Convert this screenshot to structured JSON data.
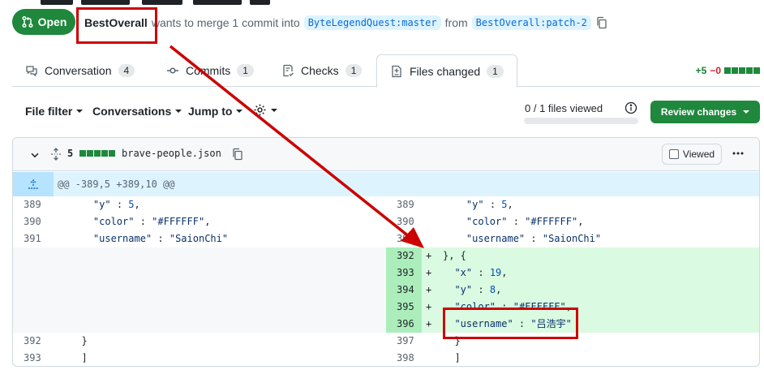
{
  "pr": {
    "state": "Open",
    "author": "BestOverall",
    "text_wants": "wants to merge 1 commit into",
    "base_branch": "ByteLegendQuest:master",
    "text_from": "from",
    "head_branch": "BestOverall:patch-2"
  },
  "tabs": [
    {
      "label": "Conversation",
      "count": "4",
      "icon": "comment-icon"
    },
    {
      "label": "Commits",
      "count": "1",
      "icon": "commit-icon"
    },
    {
      "label": "Checks",
      "count": "1",
      "icon": "checklist-icon"
    },
    {
      "label": "Files changed",
      "count": "1",
      "icon": "file-diff-icon",
      "active": true
    }
  ],
  "diffstat": {
    "added": "+5",
    "removed": "−0"
  },
  "toolbar": {
    "file_filter": "File filter",
    "conversations": "Conversations",
    "jump_to": "Jump to",
    "files_viewed": "0 / 1 files viewed",
    "files_viewed_fraction": 0,
    "review_button": "Review changes"
  },
  "file": {
    "change_count": "5",
    "name": "brave-people.json",
    "viewed_label": "Viewed",
    "hunk_header": "@@ -389,5 +389,10 @@"
  },
  "diff_rows": [
    {
      "left_num": "389",
      "left_code": "    \"y\" : 5,",
      "right_num": "389",
      "right_marker": "",
      "right_code": "    \"y\" : 5,"
    },
    {
      "left_num": "390",
      "left_code": "    \"color\" : \"#FFFFFF\",",
      "right_num": "390",
      "right_marker": "",
      "right_code": "    \"color\" : \"#FFFFFF\","
    },
    {
      "left_num": "391",
      "left_code": "    \"username\" : \"SaionChi\"",
      "right_num": "391",
      "right_marker": "",
      "right_code": "    \"username\" : \"SaionChi\""
    },
    {
      "left_num": "",
      "left_code": "",
      "right_num": "392",
      "right_marker": "+",
      "right_code": "}, {"
    },
    {
      "left_num": "",
      "left_code": "",
      "right_num": "393",
      "right_marker": "+",
      "right_code": "  \"x\" : 19,"
    },
    {
      "left_num": "",
      "left_code": "",
      "right_num": "394",
      "right_marker": "+",
      "right_code": "  \"y\" : 8,"
    },
    {
      "left_num": "",
      "left_code": "",
      "right_num": "395",
      "right_marker": "+",
      "right_code": "  \"color\" : \"#FFFFFF\","
    },
    {
      "left_num": "",
      "left_code": "",
      "right_num": "396",
      "right_marker": "+",
      "right_code": "  \"username\" : \"吕浩宇\""
    },
    {
      "left_num": "392",
      "left_code": "  }",
      "right_num": "397",
      "right_marker": "",
      "right_code": "  }"
    },
    {
      "left_num": "393",
      "left_code": "  ]",
      "right_num": "398",
      "right_marker": "",
      "right_code": "  ]"
    }
  ],
  "colors": {
    "primary_green": "#1f883d",
    "annotation_red": "#cc0000",
    "add_bg": "#dafbe1",
    "hunk_bg": "#ddf4ff"
  }
}
